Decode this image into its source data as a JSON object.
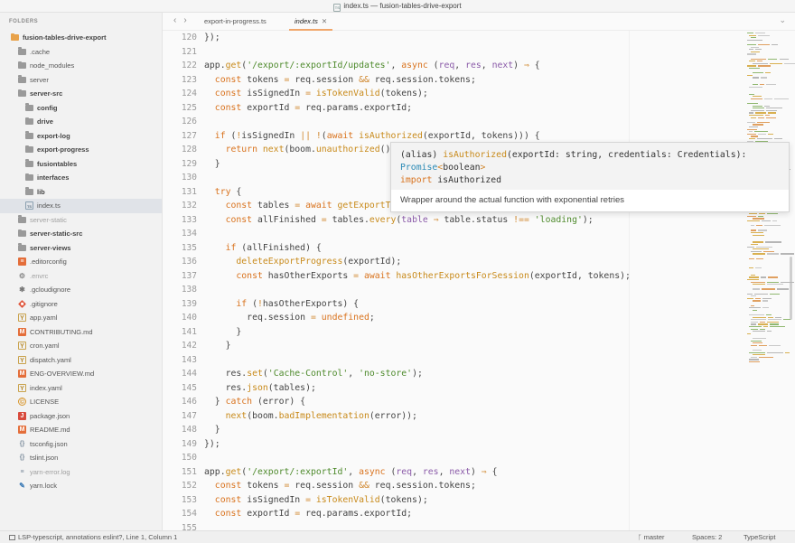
{
  "window": {
    "title": "index.ts — fusion-tables-drive-export",
    "title_icon": "TS"
  },
  "sidebar": {
    "header": "FOLDERS",
    "items": [
      {
        "label": "fusion-tables-drive-export",
        "icon": "folder-open-icon",
        "depth": 0,
        "bold": true
      },
      {
        "label": ".cache",
        "icon": "folder-icon",
        "depth": 1
      },
      {
        "label": "node_modules",
        "icon": "folder-icon",
        "depth": 1
      },
      {
        "label": "server",
        "icon": "folder-icon",
        "depth": 1
      },
      {
        "label": "server-src",
        "icon": "folder-icon",
        "depth": 1,
        "bold": true
      },
      {
        "label": "config",
        "icon": "folder-icon",
        "depth": 2,
        "bold": true
      },
      {
        "label": "drive",
        "icon": "folder-icon",
        "depth": 2,
        "bold": true
      },
      {
        "label": "export-log",
        "icon": "folder-icon",
        "depth": 2,
        "bold": true
      },
      {
        "label": "export-progress",
        "icon": "folder-icon",
        "depth": 2,
        "bold": true
      },
      {
        "label": "fusiontables",
        "icon": "folder-icon",
        "depth": 2,
        "bold": true
      },
      {
        "label": "interfaces",
        "icon": "folder-icon",
        "depth": 2,
        "bold": true
      },
      {
        "label": "lib",
        "icon": "folder-icon",
        "depth": 2,
        "bold": true
      },
      {
        "label": "index.ts",
        "icon": "typescript-file-icon",
        "depth": 2,
        "selected": true
      },
      {
        "label": "server-static",
        "icon": "folder-icon",
        "depth": 1,
        "muted": true
      },
      {
        "label": "server-static-src",
        "icon": "folder-icon",
        "depth": 1,
        "bold": true
      },
      {
        "label": "server-views",
        "icon": "folder-icon",
        "depth": 1,
        "bold": true
      },
      {
        "label": ".editorconfig",
        "icon": "editorconfig-icon",
        "depth": 1
      },
      {
        "label": ".envrc",
        "icon": "gear-icon",
        "depth": 1,
        "muted": true
      },
      {
        "label": ".gcloudignore",
        "icon": "asterisk-icon",
        "depth": 1
      },
      {
        "label": ".gitignore",
        "icon": "git-icon",
        "depth": 1
      },
      {
        "label": "app.yaml",
        "icon": "yaml-icon",
        "depth": 1
      },
      {
        "label": "CONTRIBUTING.md",
        "icon": "markdown-icon",
        "depth": 1
      },
      {
        "label": "cron.yaml",
        "icon": "yaml-icon",
        "depth": 1
      },
      {
        "label": "dispatch.yaml",
        "icon": "yaml-icon",
        "depth": 1
      },
      {
        "label": "ENG-OVERVIEW.md",
        "icon": "markdown-icon",
        "depth": 1
      },
      {
        "label": "index.yaml",
        "icon": "yaml-icon",
        "depth": 1
      },
      {
        "label": "LICENSE",
        "icon": "license-icon",
        "depth": 1
      },
      {
        "label": "package.json",
        "icon": "json-icon",
        "depth": 1
      },
      {
        "label": "README.md",
        "icon": "markdown-icon",
        "depth": 1
      },
      {
        "label": "tsconfig.json",
        "icon": "braces-icon",
        "depth": 1
      },
      {
        "label": "tslint.json",
        "icon": "braces-icon",
        "depth": 1
      },
      {
        "label": "yarn-error.log",
        "icon": "log-icon",
        "depth": 1,
        "muted": true
      },
      {
        "label": "yarn.lock",
        "icon": "yarn-icon",
        "depth": 1
      }
    ]
  },
  "tabs": [
    {
      "label": "export-in-progress.ts",
      "active": false
    },
    {
      "label": "index.ts",
      "active": true
    }
  ],
  "editor": {
    "line_numbers": [
      "120",
      "121",
      "122",
      "123",
      "124",
      "125",
      "126",
      "127",
      "128",
      "129",
      "130",
      "131",
      "132",
      "133",
      "134",
      "135",
      "136",
      "137",
      "138",
      "139",
      "140",
      "141",
      "142",
      "143",
      "144",
      "145",
      "146",
      "147",
      "148",
      "149",
      "150",
      "151",
      "152",
      "153",
      "154",
      "155"
    ],
    "lines": [
      [
        [
          "t",
          "});"
        ]
      ],
      [],
      [
        [
          "t",
          "app."
        ],
        [
          "fn",
          "get"
        ],
        [
          "t",
          "("
        ],
        [
          "str",
          "'/export/:exportId/updates'"
        ],
        [
          "t",
          ", "
        ],
        [
          "kw",
          "async"
        ],
        [
          "t",
          " ("
        ],
        [
          "par",
          "req"
        ],
        [
          "t",
          ", "
        ],
        [
          "par",
          "res"
        ],
        [
          "t",
          ", "
        ],
        [
          "par",
          "next"
        ],
        [
          "t",
          ") "
        ],
        [
          "op",
          "⇒"
        ],
        [
          "t",
          " {"
        ]
      ],
      [
        [
          "t",
          "  "
        ],
        [
          "kw",
          "const"
        ],
        [
          "t",
          " tokens "
        ],
        [
          "op",
          "="
        ],
        [
          "t",
          " req.session "
        ],
        [
          "op",
          "&&"
        ],
        [
          "t",
          " req.session.tokens;"
        ]
      ],
      [
        [
          "t",
          "  "
        ],
        [
          "kw",
          "const"
        ],
        [
          "t",
          " isSignedIn "
        ],
        [
          "op",
          "="
        ],
        [
          "t",
          " "
        ],
        [
          "fn",
          "isTokenValid"
        ],
        [
          "t",
          "(tokens);"
        ]
      ],
      [
        [
          "t",
          "  "
        ],
        [
          "kw",
          "const"
        ],
        [
          "t",
          " exportId "
        ],
        [
          "op",
          "="
        ],
        [
          "t",
          " req.params.exportId;"
        ]
      ],
      [],
      [
        [
          "t",
          "  "
        ],
        [
          "kw",
          "if"
        ],
        [
          "t",
          " ("
        ],
        [
          "op",
          "!"
        ],
        [
          "t",
          "isSignedIn "
        ],
        [
          "op",
          "||"
        ],
        [
          "t",
          " "
        ],
        [
          "op",
          "!"
        ],
        [
          "t",
          "("
        ],
        [
          "kw",
          "await"
        ],
        [
          "t",
          " "
        ],
        [
          "fn",
          "isAuthorized"
        ],
        [
          "t",
          "(exportId, tokens))) {"
        ]
      ],
      [
        [
          "t",
          "    "
        ],
        [
          "kw",
          "return"
        ],
        [
          "t",
          " "
        ],
        [
          "fn",
          "next"
        ],
        [
          "t",
          "(boom."
        ],
        [
          "fn",
          "unauthorized"
        ],
        [
          "t",
          "());"
        ]
      ],
      [
        [
          "t",
          "  }"
        ]
      ],
      [],
      [
        [
          "t",
          "  "
        ],
        [
          "kw",
          "try"
        ],
        [
          "t",
          " {"
        ]
      ],
      [
        [
          "t",
          "    "
        ],
        [
          "kw",
          "const"
        ],
        [
          "t",
          " tables "
        ],
        [
          "op",
          "="
        ],
        [
          "t",
          " "
        ],
        [
          "kw",
          "await"
        ],
        [
          "t",
          " "
        ],
        [
          "fn",
          "getExportTables"
        ],
        [
          "t",
          "(exportId);"
        ]
      ],
      [
        [
          "t",
          "    "
        ],
        [
          "kw",
          "const"
        ],
        [
          "t",
          " allFinished "
        ],
        [
          "op",
          "="
        ],
        [
          "t",
          " tables."
        ],
        [
          "fn",
          "every"
        ],
        [
          "t",
          "("
        ],
        [
          "par",
          "table"
        ],
        [
          "t",
          " "
        ],
        [
          "op",
          "⇒"
        ],
        [
          "t",
          " table.status "
        ],
        [
          "op",
          "!=="
        ],
        [
          "t",
          " "
        ],
        [
          "str",
          "'loading'"
        ],
        [
          "t",
          ");"
        ]
      ],
      [],
      [
        [
          "t",
          "    "
        ],
        [
          "kw",
          "if"
        ],
        [
          "t",
          " (allFinished) {"
        ]
      ],
      [
        [
          "t",
          "      "
        ],
        [
          "fn",
          "deleteExportProgress"
        ],
        [
          "t",
          "(exportId);"
        ]
      ],
      [
        [
          "t",
          "      "
        ],
        [
          "kw",
          "const"
        ],
        [
          "t",
          " hasOtherExports "
        ],
        [
          "op",
          "="
        ],
        [
          "t",
          " "
        ],
        [
          "kw",
          "await"
        ],
        [
          "t",
          " "
        ],
        [
          "fn",
          "hasOtherExportsForSession"
        ],
        [
          "t",
          "(exportId, tokens);"
        ]
      ],
      [],
      [
        [
          "t",
          "      "
        ],
        [
          "kw",
          "if"
        ],
        [
          "t",
          " ("
        ],
        [
          "op",
          "!"
        ],
        [
          "t",
          "hasOtherExports) {"
        ]
      ],
      [
        [
          "t",
          "        req.session "
        ],
        [
          "op",
          "="
        ],
        [
          "t",
          " "
        ],
        [
          "kw",
          "undefined"
        ],
        [
          "t",
          ";"
        ]
      ],
      [
        [
          "t",
          "      }"
        ]
      ],
      [
        [
          "t",
          "    }"
        ]
      ],
      [],
      [
        [
          "t",
          "    res."
        ],
        [
          "fn",
          "set"
        ],
        [
          "t",
          "("
        ],
        [
          "str",
          "'Cache-Control'"
        ],
        [
          "t",
          ", "
        ],
        [
          "str",
          "'no-store'"
        ],
        [
          "t",
          ");"
        ]
      ],
      [
        [
          "t",
          "    res."
        ],
        [
          "fn",
          "json"
        ],
        [
          "t",
          "(tables);"
        ]
      ],
      [
        [
          "t",
          "  } "
        ],
        [
          "kw",
          "catch"
        ],
        [
          "t",
          " (error) {"
        ]
      ],
      [
        [
          "t",
          "    "
        ],
        [
          "fn",
          "next"
        ],
        [
          "t",
          "(boom."
        ],
        [
          "fn",
          "badImplementation"
        ],
        [
          "t",
          "(error));"
        ]
      ],
      [
        [
          "t",
          "  }"
        ]
      ],
      [
        [
          "t",
          "});"
        ]
      ],
      [],
      [
        [
          "t",
          "app."
        ],
        [
          "fn",
          "get"
        ],
        [
          "t",
          "("
        ],
        [
          "str",
          "'/export/:exportId'"
        ],
        [
          "t",
          ", "
        ],
        [
          "kw",
          "async"
        ],
        [
          "t",
          " ("
        ],
        [
          "par",
          "req"
        ],
        [
          "t",
          ", "
        ],
        [
          "par",
          "res"
        ],
        [
          "t",
          ", "
        ],
        [
          "par",
          "next"
        ],
        [
          "t",
          ") "
        ],
        [
          "op",
          "⇒"
        ],
        [
          "t",
          " {"
        ]
      ],
      [
        [
          "t",
          "  "
        ],
        [
          "kw",
          "const"
        ],
        [
          "t",
          " tokens "
        ],
        [
          "op",
          "="
        ],
        [
          "t",
          " req.session "
        ],
        [
          "op",
          "&&"
        ],
        [
          "t",
          " req.session.tokens;"
        ]
      ],
      [
        [
          "t",
          "  "
        ],
        [
          "kw",
          "const"
        ],
        [
          "t",
          " isSignedIn "
        ],
        [
          "op",
          "="
        ],
        [
          "t",
          " "
        ],
        [
          "fn",
          "isTokenValid"
        ],
        [
          "t",
          "(tokens);"
        ]
      ],
      [
        [
          "t",
          "  "
        ],
        [
          "kw",
          "const"
        ],
        [
          "t",
          " exportId "
        ],
        [
          "op",
          "="
        ],
        [
          "t",
          " req.params.exportId;"
        ]
      ],
      []
    ]
  },
  "hover": {
    "signature": [
      [
        [
          "t",
          "(alias) "
        ],
        [
          "fn",
          "isAuthorized"
        ],
        [
          "t",
          "(exportId: string, credentials: Credentials):"
        ]
      ],
      [
        [
          "typ",
          "Promise"
        ],
        [
          "op",
          "<"
        ],
        [
          "t",
          "boolean"
        ],
        [
          "op",
          ">"
        ]
      ],
      [
        [
          "kw",
          "import"
        ],
        [
          "t",
          " isAuthorized"
        ]
      ]
    ],
    "doc": "Wrapper around the actual function with exponential retries"
  },
  "status": {
    "left": "LSP-typescript, annotations eslint?, Line 1, Column 1",
    "branch": "master",
    "spaces": "Spaces: 2",
    "syntax": "TypeScript"
  },
  "colors": {
    "keyword": "#d9731e",
    "function": "#c88a1a",
    "string": "#4e8a2c",
    "param": "#8a5aa8",
    "type": "#2a8ab5",
    "active_tab_underline": "#f0a66a"
  }
}
